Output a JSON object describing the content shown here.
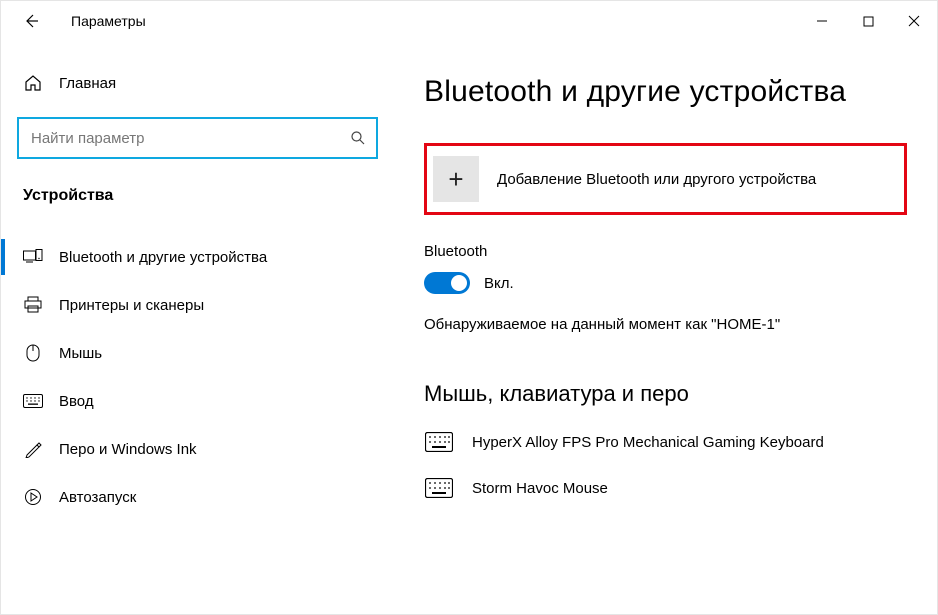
{
  "titlebar": {
    "title": "Параметры"
  },
  "sidebar": {
    "home_label": "Главная",
    "search_placeholder": "Найти параметр",
    "category_label": "Устройства",
    "items": [
      {
        "label": "Bluetooth и другие устройства",
        "active": true
      },
      {
        "label": "Принтеры и сканеры",
        "active": false
      },
      {
        "label": "Мышь",
        "active": false
      },
      {
        "label": "Ввод",
        "active": false
      },
      {
        "label": "Перо и Windows Ink",
        "active": false
      },
      {
        "label": "Автозапуск",
        "active": false
      }
    ]
  },
  "main": {
    "page_title": "Bluetooth и другие устройства",
    "add_device_label": "Добавление Bluetooth или другого устройства",
    "bluetooth_section_label": "Bluetooth",
    "bluetooth_toggle_state": "Вкл.",
    "discoverable_text": "Обнаруживаемое на данный момент как \"HOME-1\"",
    "sub_heading": "Мышь, клавиатура и перо",
    "devices": [
      {
        "name": "HyperX Alloy FPS Pro Mechanical Gaming Keyboard",
        "icon": "keyboard"
      },
      {
        "name": "Storm Havoc Mouse",
        "icon": "keyboard"
      }
    ]
  }
}
